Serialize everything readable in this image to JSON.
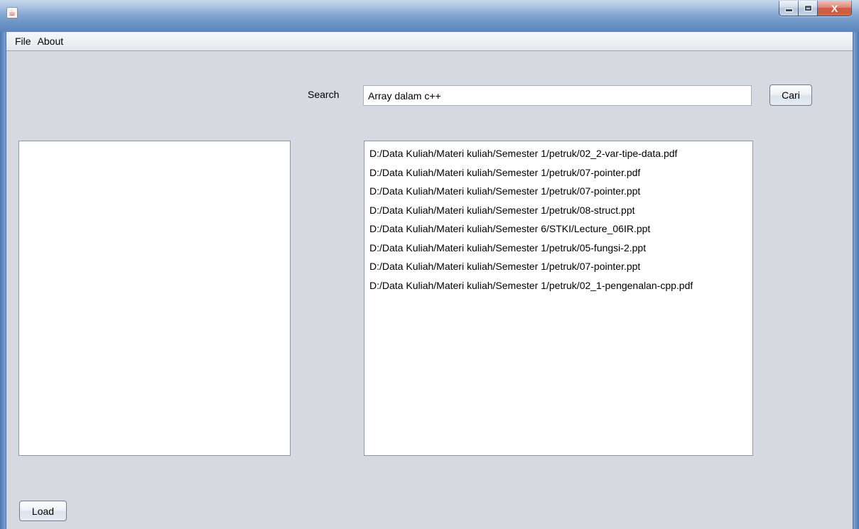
{
  "window": {
    "icon": "java-icon",
    "controls": {
      "minimize_icon": "minimize-icon",
      "maximize_icon": "maximize-icon",
      "close_icon": "close-icon",
      "close_glyph": "X"
    }
  },
  "menu": {
    "items": [
      "File",
      "About"
    ]
  },
  "search": {
    "label": "Search",
    "value": "Array dalam c++",
    "button_label": "Cari"
  },
  "left_list": {
    "items": []
  },
  "results": {
    "items": [
      "D:/Data Kuliah/Materi kuliah/Semester 1/petruk/02_2-var-tipe-data.pdf",
      "D:/Data Kuliah/Materi kuliah/Semester 1/petruk/07-pointer.pdf",
      "D:/Data Kuliah/Materi kuliah/Semester 1/petruk/07-pointer.ppt",
      "D:/Data Kuliah/Materi kuliah/Semester 1/petruk/08-struct.ppt",
      "D:/Data Kuliah/Materi kuliah/Semester 6/STKI/Lecture_06IR.ppt",
      "D:/Data Kuliah/Materi kuliah/Semester 1/petruk/05-fungsi-2.ppt",
      "D:/Data Kuliah/Materi kuliah/Semester 1/petruk/07-pointer.ppt",
      "D:/Data Kuliah/Materi kuliah/Semester 1/petruk/02_1-pengenalan-cpp.pdf"
    ]
  },
  "footer": {
    "load_label": "Load"
  }
}
